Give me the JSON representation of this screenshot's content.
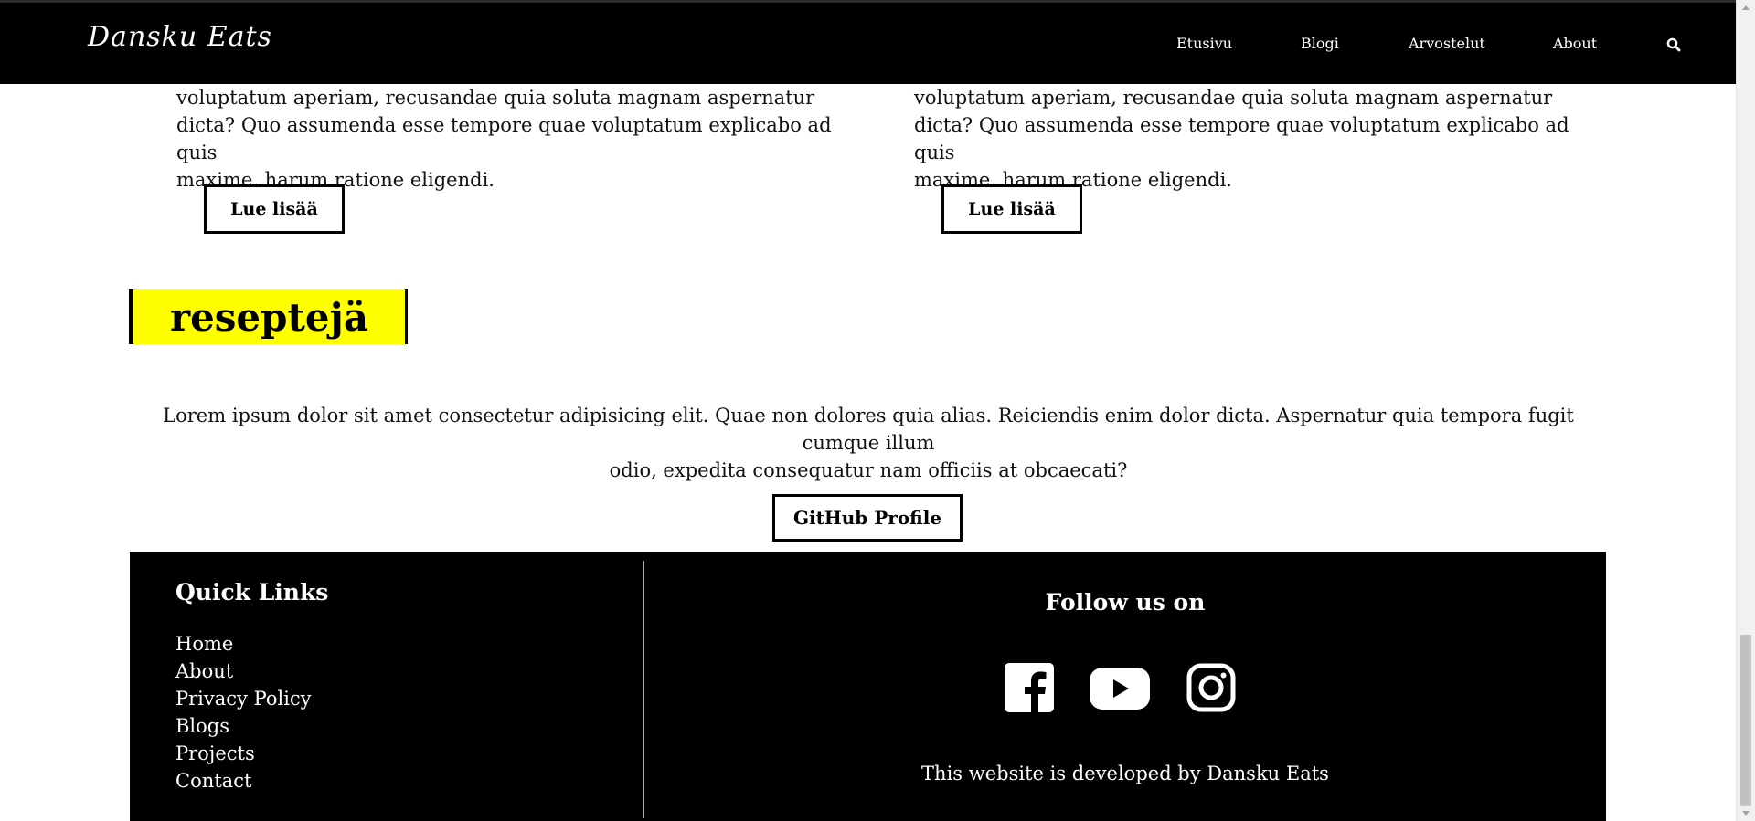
{
  "header": {
    "brand": "Dansku Eats",
    "nav": [
      "Etusivu",
      "Blogi",
      "Arvostelut",
      "About"
    ],
    "search_icon": "search-icon"
  },
  "articles": [
    {
      "text_lines": [
        "voluptatum aperiam, recusandae quia soluta magnam aspernatur",
        "dicta? Quo assumenda esse tempore quae voluptatum explicabo ad quis",
        "maxime, harum ratione eligendi."
      ],
      "button": "Lue lisää"
    },
    {
      "text_lines": [
        "voluptatum aperiam, recusandae quia soluta magnam aspernatur",
        "dicta? Quo assumenda esse tempore quae voluptatum explicabo ad quis",
        "maxime, harum ratione eligendi."
      ],
      "button": "Lue lisää"
    }
  ],
  "section": {
    "heading": "reseptejä",
    "intro_lines": [
      "Lorem ipsum dolor sit amet consectetur adipisicing elit. Quae non dolores quia alias. Reiciendis enim dolor dicta. Aspernatur quia tempora fugit cumque illum",
      "odio, expedita consequatur nam officiis at obcaecati?"
    ],
    "button": "GitHub Profile"
  },
  "footer": {
    "quick_links_title": "Quick Links",
    "quick_links": [
      "Home",
      "About",
      "Privacy Policy",
      "Blogs",
      "Projects",
      "Contact"
    ],
    "follow_title": "Follow us on",
    "social": [
      "facebook-icon",
      "youtube-icon",
      "instagram-icon"
    ],
    "credit": "This website is developed by Dansku Eats"
  },
  "colors": {
    "header_bg": "#000000",
    "accent_yellow": "#ffff00",
    "footer_bg": "#000000"
  }
}
